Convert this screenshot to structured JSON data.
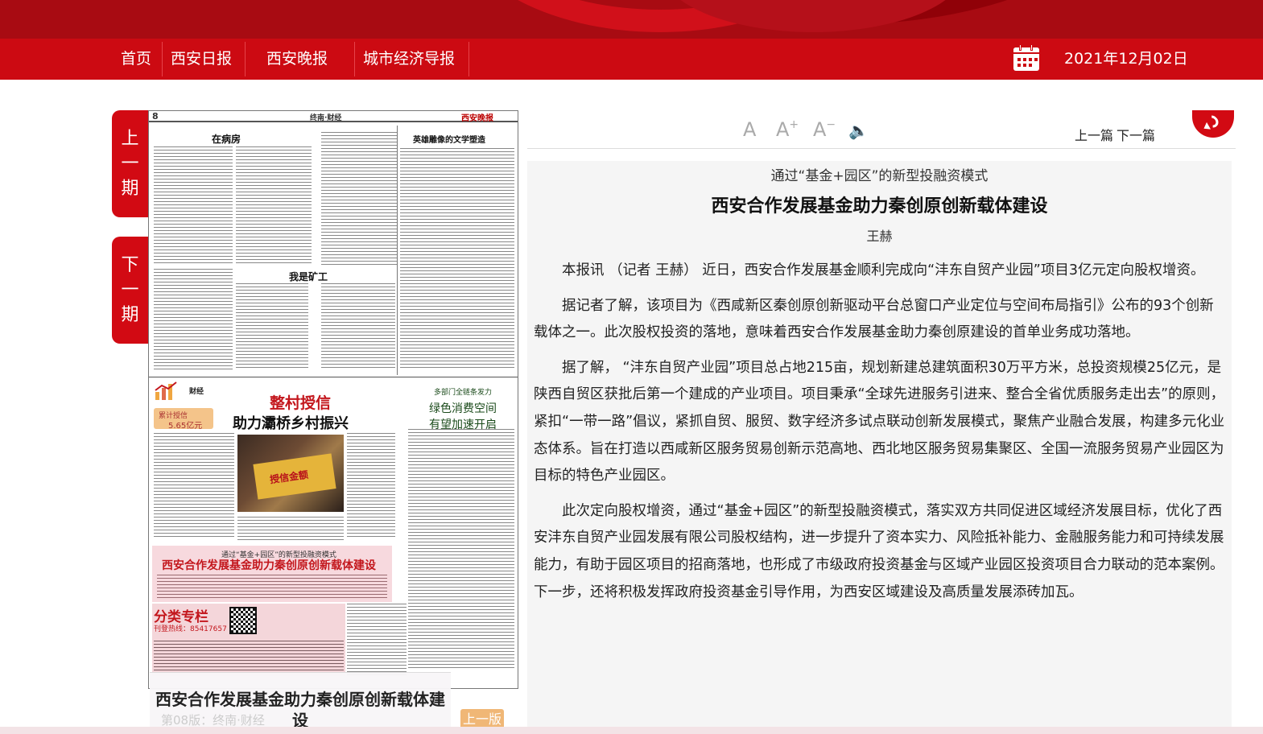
{
  "nav": {
    "home": "首页",
    "items": [
      "西安日报",
      "西安晚报",
      "城市经济导报"
    ],
    "date": "2021年12月02日"
  },
  "side": {
    "prev_issue": [
      "上",
      "一",
      "期"
    ],
    "next_issue": [
      "下",
      "一",
      "期"
    ]
  },
  "newspaper": {
    "page_no": "8",
    "section": "终南·财经",
    "brand": "西安晚报",
    "headlines": {
      "h1": "在病房",
      "h2": "英雄雕像的文学塑造",
      "h3": "我是矿工",
      "fin_label": "财经",
      "fin_box_line1": "累计授信",
      "fin_box_line2": "5.65亿元",
      "big_red": "整村授信",
      "big_black": "助力灞桥乡村振兴",
      "green_kicker": "多部门全链条发力",
      "green_title_1": "绿色消费空间",
      "green_title_2": "有望加速开启",
      "board": "授信金额",
      "pink_sub": "通过“基金+园区”的新型投融资模式",
      "pink_title": "西安合作发展基金助力秦创原创新载体建设",
      "ad_title": "分类专栏",
      "ad_phone": "刊登热线：85417657"
    }
  },
  "caption": {
    "title": "西安合作发展基金助力秦创原创新载体建设",
    "page": "第08版：终南·财经"
  },
  "prev_page_label": "上一版",
  "toolbar": {
    "font_normal": "A",
    "font_up": "A",
    "font_up_sign": "+",
    "font_down": "A",
    "font_down_sign": "−",
    "sound": "🔈",
    "prev_article": "上一篇",
    "next_article": "下一篇"
  },
  "article": {
    "subtitle": "通过“基金+园区”的新型投融资模式",
    "title": "西安合作发展基金助力秦创原创新载体建设",
    "author": "王赫",
    "paragraphs": [
      "本报讯 （记者 王赫） 近日，西安合作发展基金顺利完成向“沣东自贸产业园”项目3亿元定向股权增资。",
      "据记者了解，该项目为《西咸新区秦创原创新驱动平台总窗口产业定位与空间布局指引》公布的93个创新载体之一。此次股权投资的落地，意味着西安合作发展基金助力秦创原建设的首单业务成功落地。",
      "据了解， “沣东自贸产业园”项目总占地215亩，规划新建总建筑面积30万平方米，总投资规模25亿元，是陕西自贸区获批后第一个建成的产业项目。项目秉承“全球先进服务引进来、整合全省优质服务走出去”的原则，紧扣“一带一路”倡议，紧抓自贸、服贸、数字经济多试点联动创新发展模式，聚焦产业融合发展，构建多元化业态体系。旨在打造以西咸新区服务贸易创新示范高地、西北地区服务贸易集聚区、全国一流服务贸易产业园区为目标的特色产业园区。",
      "此次定向股权增资，通过“基金+园区”的新型投融资模式，落实双方共同促进区域经济发展目标，优化了西安沣东自贸产业园发展有限公司股权结构，进一步提升了资本实力、风险抵补能力、金融服务能力和可持续发展能力，有助于园区项目的招商落地，也形成了市级政府投资基金与区域产业园区投资项目合力联动的范本案例。下一步，还将积极发挥政府投资基金引导作用，为西安区域建设及高质量发展添砖加瓦。"
    ]
  },
  "colors": {
    "nav_red": "#cc0a12",
    "banner_red": "#a80b12",
    "tab_red": "#d20a13",
    "prev_page_orange": "#f0b776"
  }
}
